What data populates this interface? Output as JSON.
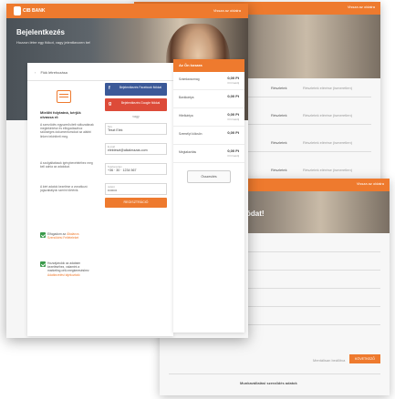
{
  "brand": {
    "name": "CIB BANK",
    "accent": "#ee7a2e"
  },
  "topbar": {
    "right_link": "Vissza az oldalra"
  },
  "back_windows": [
    {
      "title": "Vissza az oldalra",
      "rows": [
        "Részletek",
        "Részletek",
        "Részletek",
        "Részletek"
      ],
      "values": [
        "Részletek elérése (ismeretlen)",
        "Részletek elérése (ismeretlen)",
        "Részletek elérése (ismeretlen)",
        "Részletek elérése (ismeretlen)"
      ]
    },
    {
      "title": "Vissza az oldalra",
      "heading": "ódat!",
      "footer_link": "Mentálisan beállítva",
      "footer_button": "KÖVETKEZŐ",
      "bottom_row": "Munkavállalási szerződés adatok"
    }
  ],
  "hero": {
    "title": "Bejelentkezés",
    "subtitle": "Hozzon létre egy fiókot, vagy jelentkezzen be!"
  },
  "left_card": {
    "header": "Fiók létrehozása",
    "info_title": "Mielőtt folytatná, kérjük olvassa el:",
    "bullets": [
      "A szerződés egyszerűsített változatának megtekintése és elfogadásához szükséges dokumentumokat az alábbi linken tekintheti meg.",
      "A szolgáltatások igénybevételéhez meg kell adnia az adatokat.",
      "A kért adatok kezelése a vonatkozó jogszabályok szerint történik."
    ],
    "checks": [
      {
        "label": "Elfogadom az",
        "link": "Általános Szerződési Feltételeket"
      },
      {
        "label": "Hozzájárulok az adataim kezeléséhez, valamint a marketing célú megkereséshez",
        "link": "Adatkezelési tájékoztató"
      }
    ]
  },
  "form": {
    "facebook_label": "Bejelentkezés Facebook fiókkal",
    "google_label": "Bejelentkezés Google fiókkal",
    "or_text": "vagy",
    "fields": [
      {
        "label": "Név",
        "value": "Teszt Elek"
      },
      {
        "label": "E-mail",
        "value": "elekteszt@alkalmazas.com"
      },
      {
        "label": "Telefonszám",
        "value": "+36 · 30 · 1234 567"
      },
      {
        "label": "Jelszó",
        "value": "••••••••"
      }
    ],
    "register_button": "REGISZTRÁCIÓ"
  },
  "accounts": {
    "header": "Az Ön kosara",
    "items": [
      {
        "name": "Számlacsomag",
        "value": "0,00 Ft",
        "sub": "0 Ft havidíj"
      },
      {
        "name": "Bankkártya",
        "value": "0,00 Ft",
        "sub": ""
      },
      {
        "name": "Hitelkártya",
        "value": "0,00 Ft",
        "sub": "0 Ft havidíj"
      },
      {
        "name": "Személyi kölcsön",
        "value": "0,00 Ft",
        "sub": ""
      },
      {
        "name": "Megtakarítás",
        "value": "0,00 Ft",
        "sub": "0 Ft havidíj"
      }
    ],
    "summary_button": "Összesítés"
  }
}
